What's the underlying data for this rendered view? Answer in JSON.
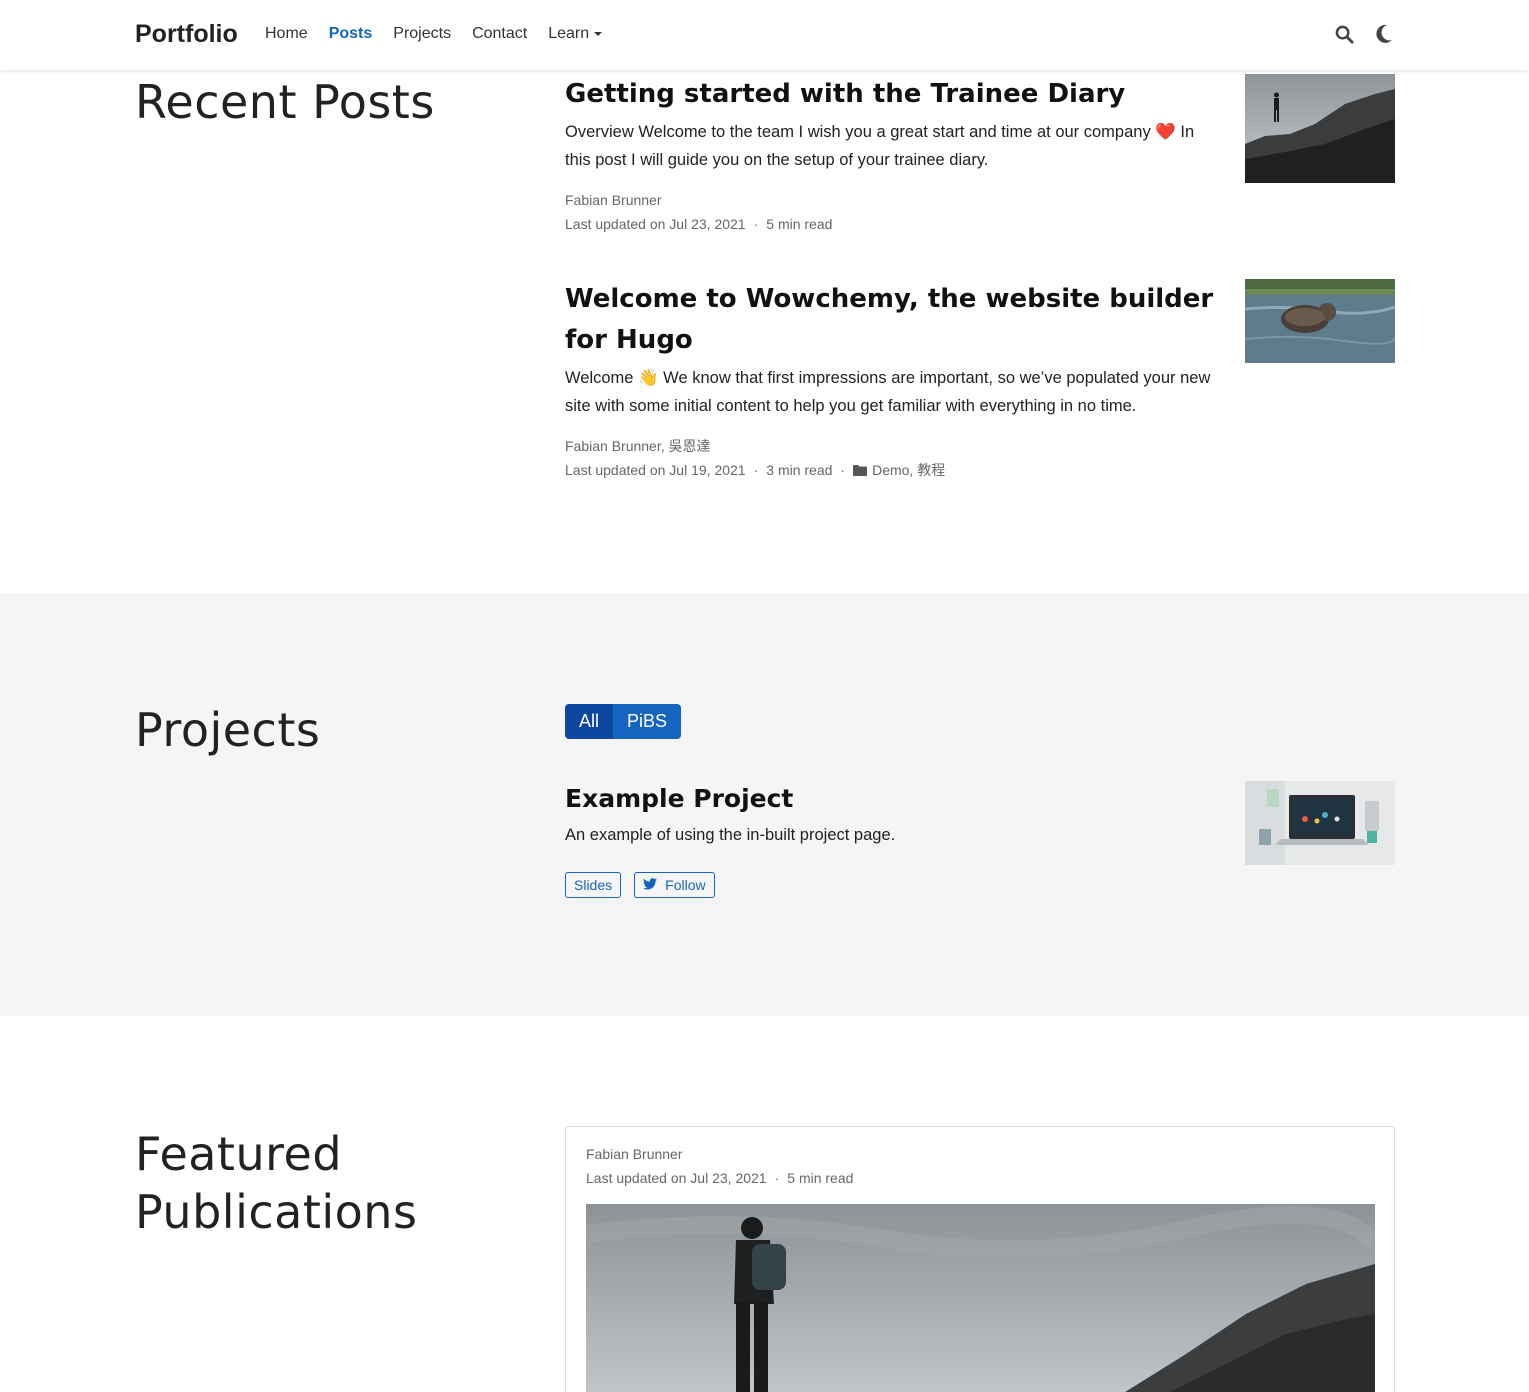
{
  "navbar": {
    "brand": "Portfolio",
    "links": [
      {
        "label": "Home"
      },
      {
        "label": "Posts"
      },
      {
        "label": "Projects"
      },
      {
        "label": "Contact"
      },
      {
        "label": "Learn"
      }
    ],
    "search_icon": "search-icon",
    "theme_icon": "moon-icon"
  },
  "recent_posts": {
    "title": "Recent Posts",
    "posts": [
      {
        "title": "Getting started with the Trainee Diary",
        "summary": "Overview Welcome to the team I wish you a great start and time at our company ❤️ In this post I will guide you on the setup of your trainee diary.",
        "authors": "Fabian Brunner",
        "updated": "Last updated on Jul 23, 2021",
        "read_time": "5 min read"
      },
      {
        "title": "Welcome to Wowchemy, the website builder for Hugo",
        "summary": "Welcome 👋 We know that first impressions are important, so we’ve populated your new site with some initial content to help you get familiar with everything in no time.",
        "authors": "Fabian Brunner, 吳恩達",
        "updated": "Last updated on Jul 19, 2021",
        "read_time": "3 min read",
        "categories": "Demo, 教程"
      }
    ]
  },
  "projects": {
    "title": "Projects",
    "filters": [
      "All",
      "PiBS"
    ],
    "items": [
      {
        "title": "Example Project",
        "summary": "An example of using the in-built project page.",
        "links": [
          "Slides",
          "Follow"
        ]
      }
    ]
  },
  "featured": {
    "title_line1": "Featured",
    "title_line2": "Publications",
    "authors": "Fabian Brunner",
    "updated": "Last updated on Jul 23, 2021",
    "read_time": "5 min read"
  },
  "colors": {
    "accent": "#1565c0",
    "accent_dark": "#0d47a1",
    "section_bg": "#f5f5f5"
  }
}
